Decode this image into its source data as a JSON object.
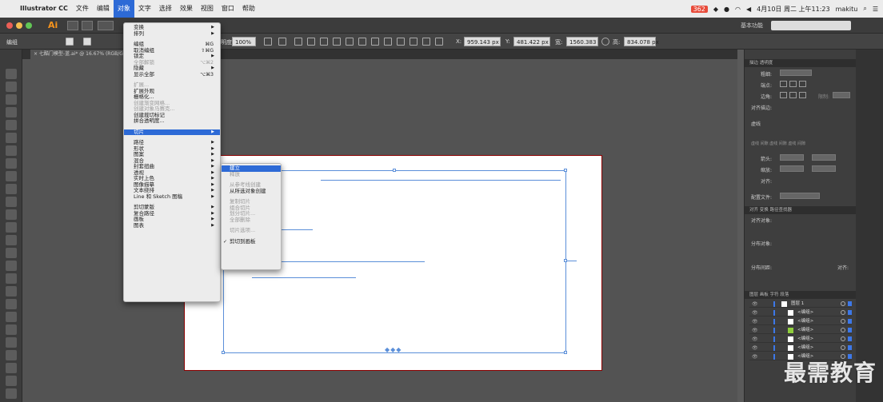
{
  "menubar": {
    "apple": "",
    "app_name": "Illustrator CC",
    "items": [
      "文件",
      "编辑",
      "对象",
      "文字",
      "选择",
      "效果",
      "视图",
      "窗口",
      "帮助"
    ],
    "active_index": 2,
    "status": {
      "notifications": "362",
      "datetime": "4月10日 周二 上午11:23",
      "user": "makitu"
    }
  },
  "titlebar": {
    "app_badge": "Ai",
    "workspace": "基本功能",
    "search_placeholder": ""
  },
  "control_bar": {
    "mode": "编组",
    "opacity_label": "不透明度:",
    "opacity": "100%",
    "x_label": "X:",
    "x": "959.143 px",
    "y_label": "Y:",
    "y": "481.422 px",
    "w_label": "宽:",
    "w": "1560.383",
    "h_label": "高:",
    "h": "834.078 px"
  },
  "document_tab": "× 七酷门模型-蓝.ai* @ 16.67% (RGB/GPU 预览)",
  "object_menu": [
    {
      "label": "变换",
      "submenu": true
    },
    {
      "label": "排列",
      "submenu": true
    },
    {
      "sep": true
    },
    {
      "label": "编组",
      "shortcut": "⌘G"
    },
    {
      "label": "取消编组",
      "shortcut": "⇧⌘G"
    },
    {
      "label": "锁定",
      "submenu": true
    },
    {
      "label": "全部解锁",
      "shortcut": "⌥⌘2",
      "disabled": true
    },
    {
      "label": "隐藏",
      "submenu": true
    },
    {
      "label": "显示全部",
      "shortcut": "⌥⌘3"
    },
    {
      "sep": true
    },
    {
      "label": "扩展...",
      "disabled": true
    },
    {
      "label": "扩展外观"
    },
    {
      "label": "栅格化..."
    },
    {
      "label": "创建渐变网格...",
      "disabled": true
    },
    {
      "label": "创建对象马赛克...",
      "disabled": true
    },
    {
      "label": "创建裁切标记"
    },
    {
      "label": "拼合透明度..."
    },
    {
      "sep": true
    },
    {
      "label": "切片",
      "submenu": true,
      "highlight": true
    },
    {
      "sep": true
    },
    {
      "label": "路径",
      "submenu": true
    },
    {
      "label": "形状",
      "submenu": true
    },
    {
      "label": "图案",
      "submenu": true
    },
    {
      "label": "混合",
      "submenu": true
    },
    {
      "label": "封套扭曲",
      "submenu": true
    },
    {
      "label": "透视",
      "submenu": true
    },
    {
      "label": "实时上色",
      "submenu": true
    },
    {
      "label": "图像描摹",
      "submenu": true
    },
    {
      "label": "文本绕排",
      "submenu": true
    },
    {
      "label": "Line 和 Sketch 图稿",
      "submenu": true
    },
    {
      "sep": true
    },
    {
      "label": "剪切蒙版",
      "submenu": true
    },
    {
      "label": "复合路径",
      "submenu": true
    },
    {
      "label": "画板",
      "submenu": true
    },
    {
      "label": "图表",
      "submenu": true
    }
  ],
  "slice_submenu": [
    {
      "label": "建立",
      "highlight": true
    },
    {
      "label": "释放",
      "disabled": true
    },
    {
      "sep": true
    },
    {
      "label": "从参考线创建",
      "disabled": true
    },
    {
      "label": "从所选对象创建"
    },
    {
      "sep": true
    },
    {
      "label": "复制切片",
      "disabled": true
    },
    {
      "label": "组合切片",
      "disabled": true
    },
    {
      "label": "划分切片...",
      "disabled": true
    },
    {
      "label": "全部删除",
      "disabled": true
    },
    {
      "sep": true
    },
    {
      "label": "切片选项...",
      "disabled": true
    },
    {
      "sep": true
    },
    {
      "label": "剪切到画板",
      "checked": true
    }
  ],
  "panels": {
    "stroke_tabs": "描边  透明度",
    "weight_label": "粗细:",
    "cap_label": "端点:",
    "corner_label": "边角:",
    "limit_label": "限制:",
    "align_label": "对齐描边:",
    "dashed_label": "虚线",
    "dash_cells": "虚线  间隙  虚线  间隙  虚线  间隙",
    "arrow_label": "箭头:",
    "scale_label": "缩放:",
    "align2_label": "对齐:",
    "profile_label": "配置文件:",
    "align_tabs": "对齐  变换  路径查找器",
    "align_objects": "对齐对象:",
    "distribute_objects": "分布对象:",
    "distribute_spacing": "分布间距:",
    "align_to": "对齐:",
    "layers_tabs": "图层  画板  字符  段落",
    "layers": [
      {
        "name": "图层 1",
        "swatch": "#ffffff"
      },
      {
        "name": "<编组>",
        "swatch": "#ffffff"
      },
      {
        "name": "<编组>",
        "swatch": "#ffffff"
      },
      {
        "name": "<编组>",
        "swatch": "#8fce3c"
      },
      {
        "name": "<编组>",
        "swatch": "#ffffff"
      },
      {
        "name": "<编组>",
        "swatch": "#ffffff"
      },
      {
        "name": "<编组>",
        "swatch": "#ffffff"
      }
    ]
  },
  "watermark": "最需教育"
}
